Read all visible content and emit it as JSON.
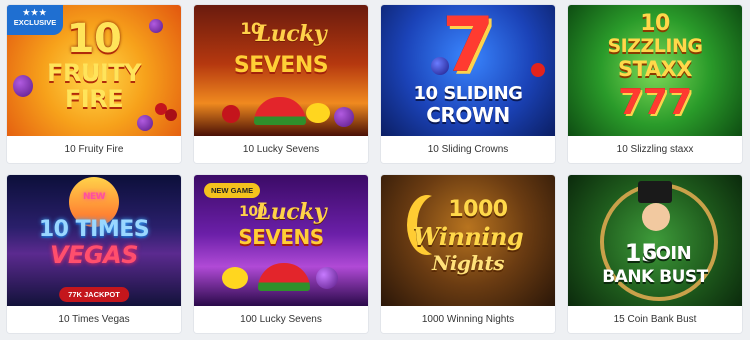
{
  "games": [
    {
      "caption": "10 Fruity Fire",
      "art_line1": "10",
      "art_line2": "FRUITY",
      "art_line3": "FIRE",
      "badge": "EXCLUSIVE"
    },
    {
      "caption": "10 Lucky Sevens",
      "art_line1": "10",
      "art_line2": "Lucky",
      "art_line3": "SEVENS"
    },
    {
      "caption": "10 Sliding Crowns",
      "art_line1": "7",
      "art_line2": "10 SLIDING",
      "art_line3": "CROWN"
    },
    {
      "caption": "10 Slizzling staxx",
      "art_line1": "10",
      "art_line2": "SIZZLING",
      "art_line3": "STAXX",
      "art_line4": "777"
    },
    {
      "caption": "10 Times Vegas",
      "art_line1": "NEW",
      "art_line2": "10 TIMES",
      "art_line3": "VEGAS",
      "badge": "77K JACKPOT"
    },
    {
      "caption": "100 Lucky Sevens",
      "art_line1": "100",
      "art_line2": "Lucky",
      "art_line3": "SEVENS",
      "badge": "NEW GAME"
    },
    {
      "caption": "1000 Winning Nights",
      "art_line1": "1000",
      "art_line2": "Winning",
      "art_line3": "Nights"
    },
    {
      "caption": "15 Coin Bank Bust",
      "art_line1": "15",
      "art_line2": "COIN",
      "art_line3": "BANK BUST"
    }
  ],
  "colors": {
    "exclusive_badge": "#1f6fd1",
    "new_game_badge": "#f4c21d",
    "jackpot_badge": "#c4161c"
  }
}
